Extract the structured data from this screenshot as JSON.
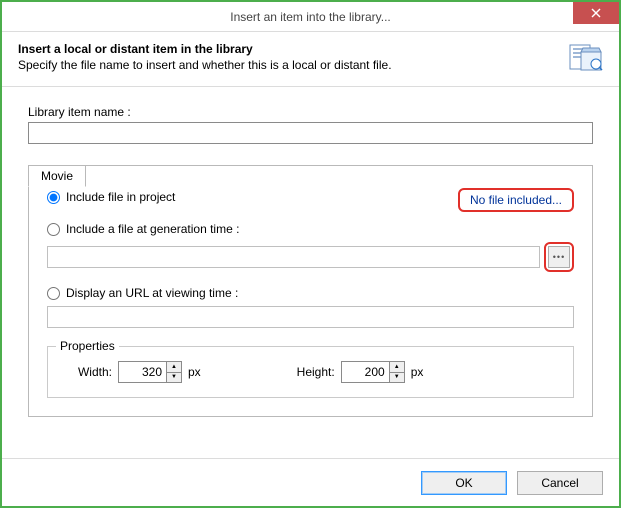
{
  "window": {
    "title": "Insert an item into the library..."
  },
  "header": {
    "heading": "Insert a local or distant item in the library",
    "sub": "Specify the file name to insert and whether this is a local or distant file."
  },
  "library": {
    "name_label": "Library item name :",
    "name_value": ""
  },
  "tabs": {
    "movie": "Movie"
  },
  "movie": {
    "include_project": "Include file in project",
    "include_generation": "Include a file at generation time :",
    "display_url": "Display an URL at viewing time :",
    "no_file_badge": "No file included...",
    "gen_path": "",
    "url_value": "",
    "selected": "include_project"
  },
  "properties": {
    "legend": "Properties",
    "width_label": "Width:",
    "width_value": "320",
    "height_label": "Height:",
    "height_value": "200",
    "unit": "px"
  },
  "footer": {
    "ok": "OK",
    "cancel": "Cancel"
  }
}
